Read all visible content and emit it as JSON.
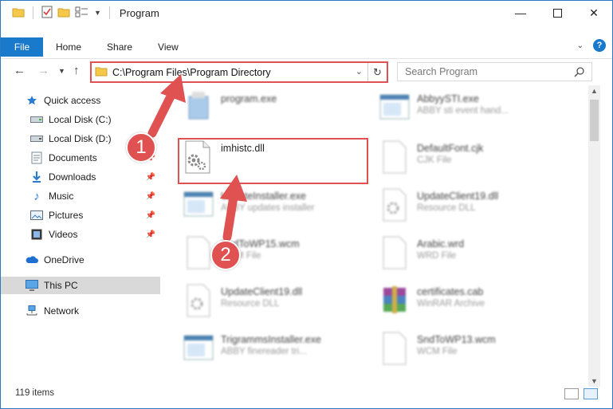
{
  "window": {
    "title": "Program",
    "controls": [
      "minimize",
      "maximize",
      "close"
    ]
  },
  "ribbon": {
    "tabs": [
      "File",
      "Home",
      "Share",
      "View"
    ],
    "help_label": "?"
  },
  "navbar": {
    "address_path": "C:\\Program Files\\Program Directory",
    "search_placeholder": "Search Program"
  },
  "sidebar": {
    "items": [
      {
        "label": "Quick access",
        "icon": "star-icon",
        "pinned": false
      },
      {
        "label": "Local Disk (C:)",
        "icon": "drive-icon",
        "pinned": false
      },
      {
        "label": "Local Disk (D:)",
        "icon": "drive-icon",
        "pinned": false
      },
      {
        "label": "Documents",
        "icon": "documents-icon",
        "pinned": true
      },
      {
        "label": "Downloads",
        "icon": "download-arrow-icon",
        "pinned": true
      },
      {
        "label": "Music",
        "icon": "music-note-icon",
        "pinned": true
      },
      {
        "label": "Pictures",
        "icon": "pictures-icon",
        "pinned": true
      },
      {
        "label": "Videos",
        "icon": "film-icon",
        "pinned": true
      },
      {
        "label": "OneDrive",
        "icon": "cloud-icon",
        "pinned": false
      },
      {
        "label": "This PC",
        "icon": "monitor-icon",
        "pinned": false,
        "selected": true
      },
      {
        "label": "Network",
        "icon": "network-icon",
        "pinned": false
      }
    ]
  },
  "files": [
    {
      "name": "program.exe",
      "desc": "",
      "icon": "installer-icon",
      "blurred": true
    },
    {
      "name": "AbbyySTI.exe",
      "desc": "ABBY sti event hand...",
      "icon": "window-app-icon",
      "blurred": true
    },
    {
      "name": "imhistc.dll",
      "desc": "",
      "icon": "dll-gear-icon",
      "blurred": false,
      "highlighted": true
    },
    {
      "name": "DefaultFont.cjk",
      "desc": "CJK File",
      "icon": "blank-file-icon",
      "blurred": true
    },
    {
      "name": "UpdateInstaller.exe",
      "desc": "ABBY updates installer",
      "icon": "window-app-icon",
      "blurred": true
    },
    {
      "name": "UpdateClient19.dll",
      "desc": "Resource DLL",
      "icon": "dll-gear-icon",
      "blurred": true
    },
    {
      "name": "SndToWP15.wcm",
      "desc": "WCM File",
      "icon": "blank-file-icon",
      "blurred": true
    },
    {
      "name": "Arabic.wrd",
      "desc": "WRD File",
      "icon": "blank-file-icon",
      "blurred": true
    },
    {
      "name": "UpdateClient19.dll",
      "desc": "Resource DLL",
      "icon": "dll-gear-icon",
      "blurred": true
    },
    {
      "name": "certificates.cab",
      "desc": "WinRAR Archive",
      "icon": "winrar-icon",
      "blurred": true
    },
    {
      "name": "TrigrammsInstaller.exe",
      "desc": "ABBY finereader tri...",
      "icon": "window-app-icon",
      "blurred": true
    },
    {
      "name": "SndToWP13.wcm",
      "desc": "WCM File",
      "icon": "blank-file-icon",
      "blurred": true
    }
  ],
  "status": {
    "item_count": "119 items"
  },
  "annotations": {
    "step1": "1",
    "step2": "2",
    "color": "#e05252"
  }
}
